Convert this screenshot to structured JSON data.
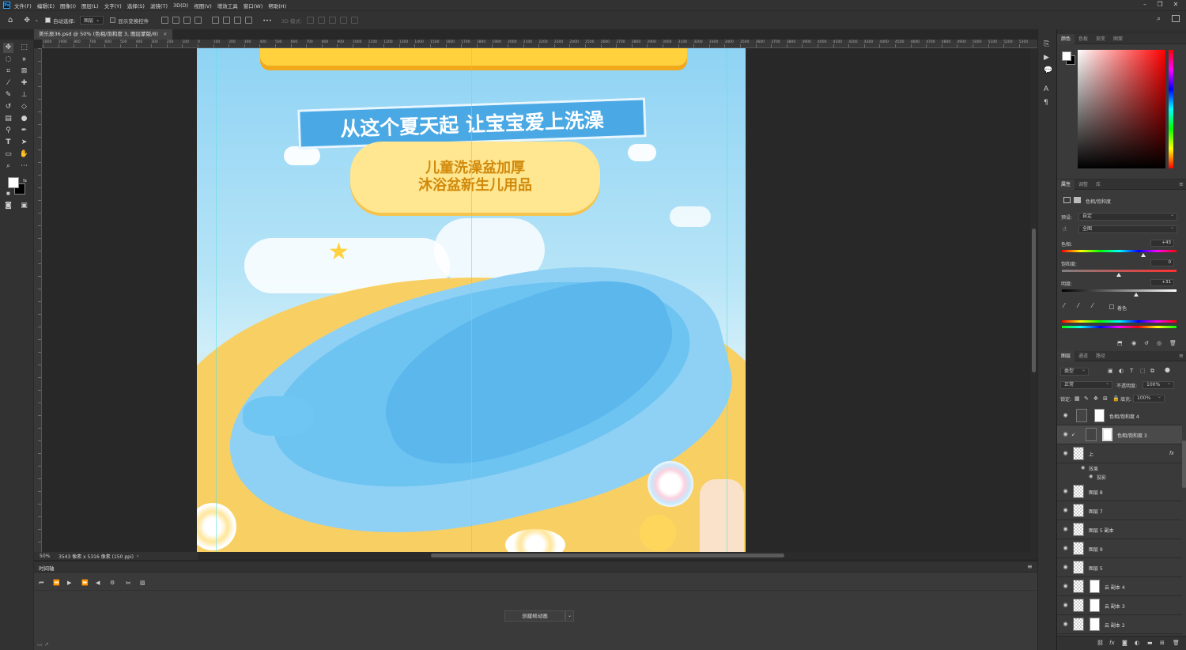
{
  "menubar": {
    "logo": "Ps",
    "items": [
      "文件(F)",
      "编辑(E)",
      "图像(I)",
      "图层(L)",
      "文字(Y)",
      "选择(S)",
      "滤镜(T)",
      "3D(D)",
      "视图(V)",
      "增效工具",
      "窗口(W)",
      "帮助(H)"
    ]
  },
  "options": {
    "auto_select": "自动选择:",
    "auto_select_target": "图层",
    "show_transform": "显示变换控件",
    "mode_3d": "3D 模式:",
    "more": "•••"
  },
  "document": {
    "tab_title": "美乐辰36.psd @ 50% (色相/饱和度 3, 图层蒙版/8)",
    "close": "×"
  },
  "ruler_h_labels": [
    "1800",
    "1900",
    "800",
    "700",
    "600",
    "500",
    "400",
    "300",
    "200",
    "100",
    "0",
    "100",
    "200",
    "300",
    "400",
    "500",
    "600",
    "700",
    "800",
    "900",
    "1000",
    "1100",
    "1200",
    "1300",
    "1400",
    "1500",
    "1600",
    "1700",
    "1800",
    "1900",
    "2000",
    "2100",
    "2200",
    "2300",
    "2400",
    "2500",
    "2600",
    "2700",
    "2800",
    "2900",
    "3000",
    "3100",
    "3200",
    "3300",
    "3400",
    "3500",
    "3600",
    "3700",
    "3800",
    "3900",
    "4000",
    "4100",
    "4200",
    "4300",
    "4400",
    "4500",
    "4600",
    "4700",
    "4800",
    "4900",
    "5000",
    "5100",
    "5200",
    "5300"
  ],
  "artwork": {
    "banner_text": "从这个夏天起  让宝宝爱上洗澡",
    "subtitle_line1": "儿童洗澡盆加厚",
    "subtitle_line2": "沐浴盆新生儿用品"
  },
  "status": {
    "zoom": "50%",
    "doc_info": "3543 像素 x 5316 像素 (150 ppi)",
    "arrow": "›"
  },
  "timeline": {
    "title": "时间轴",
    "create_button": "创建帧动画",
    "dropdown": "⌄"
  },
  "color_panel": {
    "tabs": [
      "颜色",
      "色板",
      "渐变",
      "图案"
    ],
    "colors": {
      "hue": "#ff0000",
      "fg": "#ffffff",
      "bg": "#000000"
    }
  },
  "properties_panel": {
    "tabs": [
      "属性",
      "调整",
      "库"
    ],
    "type_label": "色相/饱和度",
    "preset_label": "预设:",
    "preset_value": "自定",
    "channel_value": "全图",
    "hue_label": "色相:",
    "hue_value": "+43",
    "sat_label": "饱和度:",
    "sat_value": "0",
    "light_label": "明度:",
    "light_value": "+31",
    "colorize_label": "着色"
  },
  "layers_panel": {
    "tabs": [
      "图层",
      "通道",
      "路径"
    ],
    "filter_kind": "类型",
    "blend_mode": "正常",
    "opacity_label": "不透明度:",
    "opacity_value": "100%",
    "lock_label": "锁定:",
    "fill_label": "填充:",
    "fill_value": "100%",
    "layers": [
      {
        "name": "色相/饱和度 4",
        "kind": "adjustment"
      },
      {
        "name": "色相/饱和度 3",
        "kind": "adjustment",
        "selected": true
      },
      {
        "name": "上",
        "kind": "pixel",
        "fx": "fx"
      },
      {
        "name": "图层 8",
        "kind": "pixel"
      },
      {
        "name": "图层 7",
        "kind": "pixel"
      },
      {
        "name": "图层 5 副本",
        "kind": "pixel"
      },
      {
        "name": "图层 9",
        "kind": "pixel"
      },
      {
        "name": "图层 5",
        "kind": "pixel"
      },
      {
        "name": "云 副本 4",
        "kind": "masked"
      },
      {
        "name": "云 副本 3",
        "kind": "masked"
      },
      {
        "name": "云 副本 2",
        "kind": "masked"
      }
    ],
    "effects_label": "效果",
    "drop_shadow_label": "投影"
  }
}
